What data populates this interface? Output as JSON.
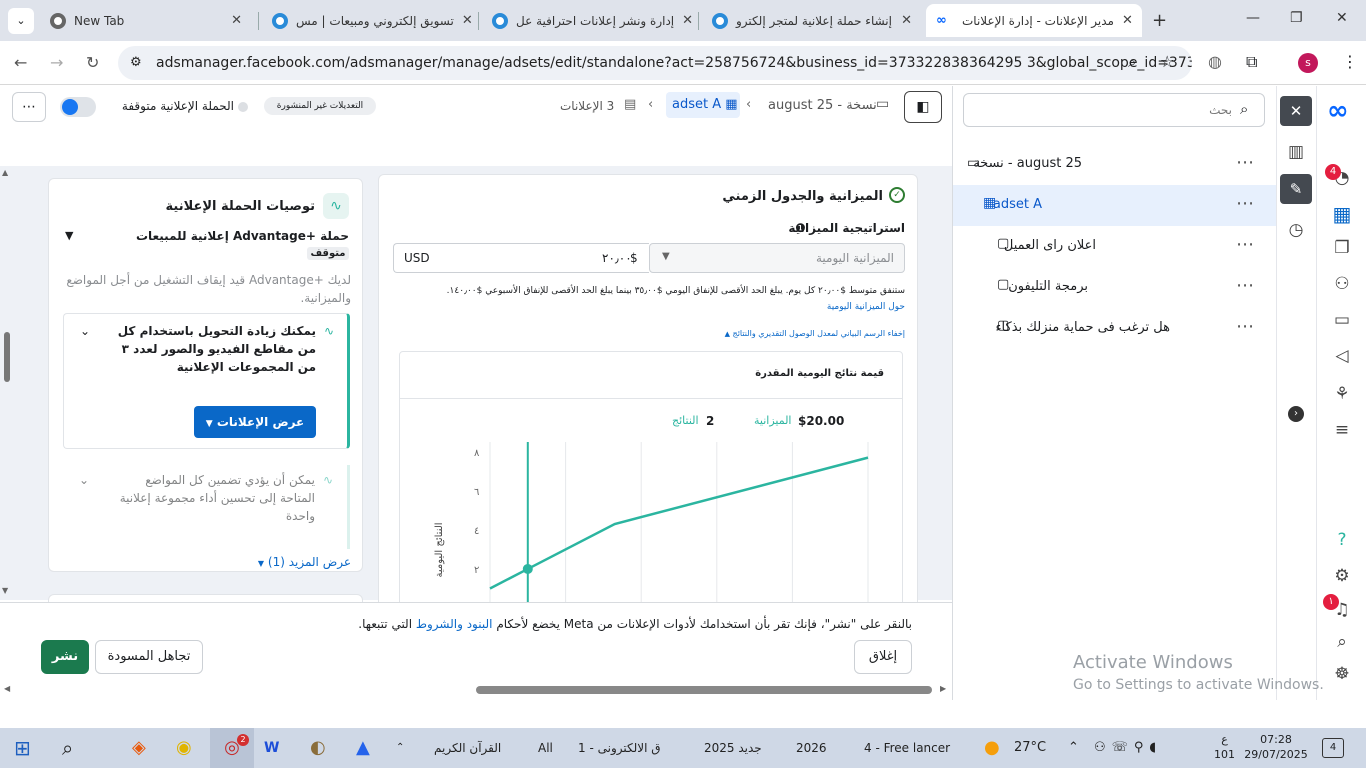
{
  "browser": {
    "tabs": [
      {
        "title": "New Tab"
      },
      {
        "title": "تسويق إلكتروني ومبيعات | مس"
      },
      {
        "title": "إدارة ونشر إعلانات احترافية عل"
      },
      {
        "title": "إنشاء حملة إعلانية لمتجر إلكترو"
      },
      {
        "title": "مدير الإعلانات - إدارة الإعلانات"
      }
    ],
    "url": "adsmanager.facebook.com/adsmanager/manage/adsets/edit/standalone?act=258756724&business_id=373322838364295 3&global_scope_id=37332283...",
    "profile_initial": "s"
  },
  "header": {
    "campaign_toggle_label": "الحملة الإعلانية متوقفة",
    "unpublished_badge": "التعديلات غير المنشورة",
    "breadcrumb": {
      "ads_count": "3 الإعلانات",
      "adset": "adset A",
      "campaign": "august 25 - نسخة"
    }
  },
  "budget": {
    "section_title": "الميزانية والجدول الزمني",
    "strategy_label": "استراتيجية الميزانية",
    "budget_type": "الميزانية اليومية",
    "currency_symbol": "$",
    "amount": "٢٠٫٠٠",
    "currency": "USD",
    "description": "ستنفق متوسط $٢٠٫٠٠ كل يوم. يبلغ الحد الأقصى للإنفاق اليومي $٣٥٫٠٠ بينما يبلغ الحد الأقصى للإنفاق الأسبوعي $١٤٠٫٠٠.",
    "about_link": "حول الميزانية اليومية",
    "hide_chart_link": "إخفاء الرسم البياني لمعدل الوصول التقديري والنتائج",
    "chart_title": "قيمة نتائج اليومية المقدرة",
    "summary_budget_value": "$20.00",
    "summary_budget_label": "الميزانية",
    "summary_results_value": "2",
    "summary_results_label": "النتائج"
  },
  "chart_data": {
    "type": "line",
    "ylabel": "النتائج اليومية",
    "y_ticks": [
      "٨",
      "٦",
      "٤",
      "٢"
    ],
    "ylim": [
      0,
      8.5
    ],
    "x": [
      0.0,
      0.1,
      0.33,
      1.0
    ],
    "series": [
      {
        "values": [
          1.0,
          2.0,
          4.3,
          7.7
        ]
      }
    ],
    "marker_x": 0.1,
    "color": "#2bb5a0"
  },
  "recommendations": {
    "title": "توصيات الحملة الإعلانية",
    "campaign_type": "حملة +Advantage إعلانية للمبيعات",
    "status": "متوقف",
    "desc": "لديك +Advantage قيد إيقاف التشغيل من أجل المواضع والميزانية.",
    "rec1": "يمكنك زيادة التحويل باستخدام كل من مقاطع الفيديو والصور لعدد ٣ من المجموعات الإعلانية",
    "rec1_button": "عرض الإعلانات",
    "rec2": "يمكن أن يؤدي تضمين كل المواضع المتاحة إلى تحسين أداء مجموعة إعلانية واحدة",
    "show_more": "عرض المزيد (1)"
  },
  "footer": {
    "terms_prefix": "بالنقر على \"نشر\"، فإنك تقر بأن استخدامك لأدوات الإعلانات من Meta يخضع لأحكام",
    "terms_link": "البنود والشروط",
    "terms_suffix": "التي تتبعها.",
    "close_button": "إغلاق",
    "discard_button": "تجاهل المسودة",
    "publish_button": "نشر"
  },
  "sidebar": {
    "search_placeholder": "بحث",
    "items": [
      {
        "label": "august 25 - نسخة"
      },
      {
        "label": "adset A"
      },
      {
        "label": "اعلان راى العميل"
      },
      {
        "label": "برمجة التليفون"
      },
      {
        "label": "هل ترغب فى حماية منزلك بذكاء"
      }
    ]
  },
  "metabar": {
    "notif_count_1": "4",
    "notif_count_2": "١"
  },
  "activate_windows": {
    "line1": "Activate Windows",
    "line2": "Go to Settings to activate Windows."
  },
  "taskbar": {
    "items": [
      "القرآن الكريم",
      "All",
      "ق الالكترونى - 1",
      "جديد 2025",
      "2026",
      "4 - Free lancer"
    ],
    "temperature": "27°C",
    "lang_line1": "ع",
    "lang_line2": "101",
    "time": "07:28",
    "date": "29/07/2025",
    "notifications": "4",
    "chrome_badge": "2"
  },
  "colors": {
    "accent": "#0a68c8",
    "publish": "#1b7a4e",
    "chart": "#2bb5a0"
  }
}
